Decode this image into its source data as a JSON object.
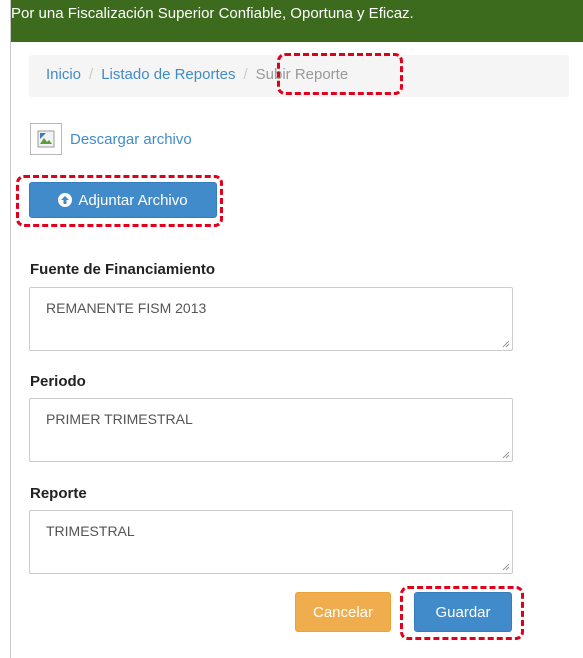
{
  "header": {
    "tagline": "Por una Fiscalización Superior Confiable, Oportuna y Eficaz."
  },
  "breadcrumb": {
    "home": "Inicio",
    "list": "Listado de Reportes",
    "current": "Subir Reporte",
    "separator": "/"
  },
  "download": {
    "icon": "broken-image-icon",
    "label": "Descargar archivo"
  },
  "attach": {
    "icon": "arrow-up-circle-icon",
    "label": "Adjuntar Archivo"
  },
  "form": {
    "funding_label": "Fuente de Financiamiento",
    "funding_value": "REMANENTE FISM 2013",
    "period_label": "Periodo",
    "period_value": "PRIMER TRIMESTRAL",
    "report_label": "Reporte",
    "report_value": "TRIMESTRAL"
  },
  "actions": {
    "cancel": "Cancelar",
    "save": "Guardar"
  },
  "colors": {
    "header": "#3d6b1e",
    "primary": "#428bca",
    "warning": "#f0ad4e",
    "highlight": "#e0001b"
  }
}
